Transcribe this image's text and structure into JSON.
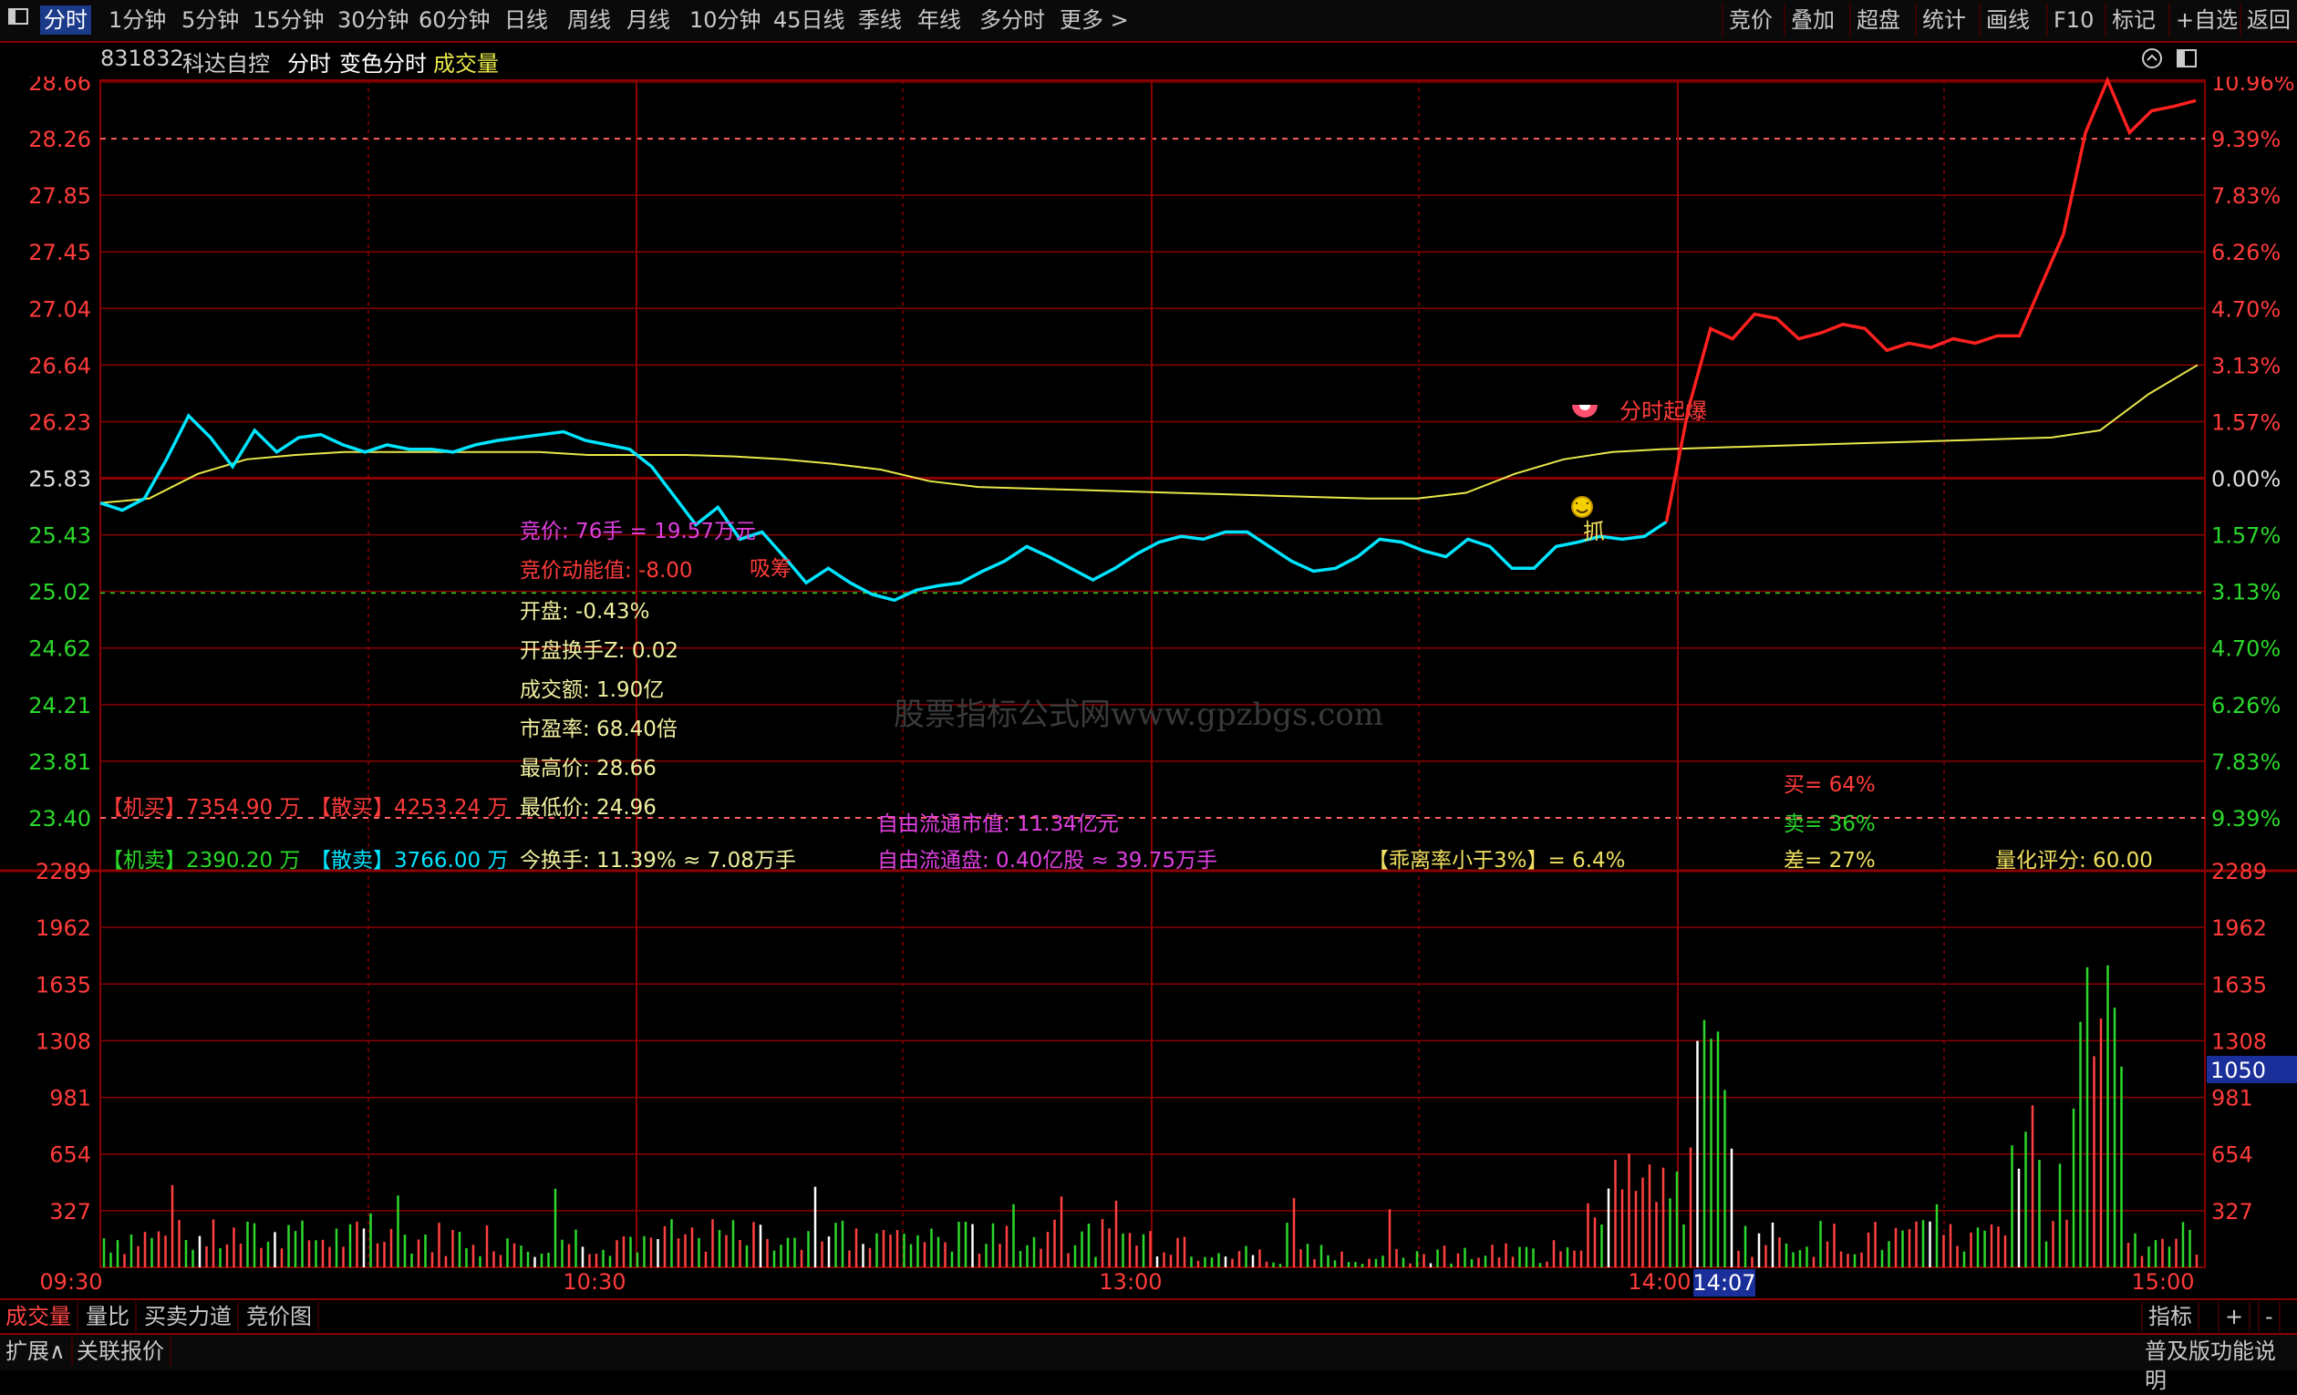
{
  "topbar": {
    "periods": [
      "分时",
      "1分钟",
      "5分钟",
      "15分钟",
      "30分钟",
      "60分钟",
      "日线",
      "周线",
      "月线",
      "10分钟",
      "45日线",
      "季线",
      "年线",
      "多分时",
      "更多 >"
    ],
    "active_period": 0,
    "tools": [
      "竞价",
      "叠加",
      "超盘",
      "统计",
      "画线",
      "F10",
      "标记",
      "+自选",
      "返回"
    ]
  },
  "info": {
    "code": "831832",
    "name": "科达自控",
    "mode": "分时",
    "indicator": "变色分时",
    "volume_label": "成交量"
  },
  "price_axis": {
    "left": [
      "28.66",
      "28.26",
      "27.85",
      "27.45",
      "27.04",
      "26.64",
      "26.23",
      "25.83",
      "25.43",
      "25.02",
      "24.62",
      "24.21",
      "23.81",
      "23.40"
    ],
    "right": [
      "10.96%",
      "9.39%",
      "7.83%",
      "6.26%",
      "4.70%",
      "3.13%",
      "1.57%",
      "0.00%",
      "1.57%",
      "3.13%",
      "4.70%",
      "6.26%",
      "7.83%",
      "9.39%"
    ]
  },
  "volume_axis": {
    "left": [
      "2289",
      "1962",
      "1635",
      "1308",
      "981",
      "654",
      "327"
    ],
    "right": [
      "2289",
      "1962",
      "1635",
      "1308",
      "981",
      "654",
      "327"
    ],
    "current": "1050"
  },
  "time_axis": [
    "09:30",
    "10:30",
    "13:00",
    "14:00",
    "15:00"
  ],
  "time_cursor": "14:07",
  "annotations": {
    "bid": "竞价: 76手 = 19.57万元",
    "bid_energy": "竞价动能值: -8.00",
    "suck": "吸筹",
    "open": "开盘: -0.43%",
    "open_turnover": "开盘换手Z: 0.02",
    "amount": "成交额: 1.90亿",
    "pe": "市盈率: 68.40倍",
    "high": "最高价: 28.66",
    "low": "最低价: 24.96",
    "turnover": "今换手: 11.39% ≈ 7.08万手",
    "inst_buy": "【机买】7354.90 万",
    "retail_buy": "【散买】4253.24 万",
    "inst_sell": "【机卖】2390.20 万",
    "retail_sell": "【散卖】3766.00 万",
    "free_cap": "自由流通市值: 11.34亿元",
    "free_float": "自由流通盘: 0.40亿股 ≈ 39.75万手",
    "deviation": "【乖离率小于3%】= 6.4%",
    "buy_pct": "买= 64%",
    "sell_pct": "卖= 36%",
    "diff_pct": "差= 27%",
    "score": "量化评分: 60.00",
    "surge": "分时起爆",
    "grab": "抓"
  },
  "watermark": "股票指标公式网www.gpzbgs.com",
  "bottom_tabs": [
    "成交量",
    "量比",
    "买卖力道",
    "竞价图"
  ],
  "bottom_right": [
    "指标",
    "+",
    "-"
  ],
  "bottom2": [
    "扩展∧",
    "关联报价"
  ],
  "bottom2_right": "普及版功能说明",
  "colors": {
    "grid": "#8b0000",
    "price_line_down": "#00e5ff",
    "price_line_up": "#ff2020",
    "avg_line": "#e8e84a",
    "up_text": "#ff3b3b",
    "down_text": "#2bd82b",
    "label_yellow": "#f0e060",
    "label_magenta": "#e040e0",
    "vol_red": "#ff4040",
    "vol_green": "#2bd82b",
    "vol_white": "#ffffff"
  },
  "chart_data": {
    "type": "line",
    "base_price": 25.83,
    "y_range": [
      23.4,
      28.66
    ],
    "x": [
      "09:30",
      "10:30",
      "13:00",
      "14:00",
      "15:00"
    ],
    "series": [
      {
        "values": [
          25.75,
          25.7,
          25.78,
          26.05,
          26.35,
          26.2,
          26.0,
          26.25,
          26.1,
          26.2,
          26.22,
          26.15,
          26.1,
          26.15,
          26.12,
          26.12,
          26.1,
          26.15,
          26.18,
          26.2,
          26.22,
          26.24,
          26.18,
          26.15,
          26.12,
          26.0,
          25.8,
          25.6,
          25.72,
          25.5,
          25.55,
          25.38,
          25.2,
          25.3,
          25.2,
          25.12,
          25.08,
          25.15,
          25.18,
          25.2,
          25.28,
          25.35,
          25.45,
          25.38,
          25.3,
          25.22,
          25.3,
          25.4,
          25.48,
          25.52,
          25.5,
          25.55,
          25.55,
          25.45,
          25.35,
          25.28,
          25.3,
          25.38,
          25.5,
          25.48,
          25.42,
          25.38,
          25.5,
          25.45,
          25.3,
          25.3,
          25.45,
          25.48,
          25.52,
          25.5,
          25.52,
          25.62,
          26.4,
          26.95,
          26.88,
          27.05,
          27.02,
          26.88,
          26.92,
          26.98,
          26.95,
          26.8,
          26.85,
          26.82,
          26.88,
          26.85,
          26.9,
          26.9,
          27.25,
          27.6,
          28.3,
          28.66,
          28.3,
          28.45,
          28.48,
          28.52
        ],
        "color": "#00e5ff"
      },
      {
        "values": [
          25.75,
          25.78,
          25.95,
          26.05,
          26.08,
          26.1,
          26.1,
          26.1,
          26.1,
          26.1,
          26.08,
          26.08,
          26.08,
          26.07,
          26.05,
          26.02,
          25.98,
          25.9,
          25.86,
          25.85,
          25.84,
          25.83,
          25.82,
          25.81,
          25.8,
          25.79,
          25.78,
          25.78,
          25.82,
          25.95,
          26.05,
          26.1,
          26.12,
          26.13,
          26.14,
          26.15,
          26.16,
          26.17,
          26.18,
          26.19,
          26.2,
          26.25,
          26.5,
          26.7
        ],
        "color": "#e8e84a"
      }
    ]
  }
}
